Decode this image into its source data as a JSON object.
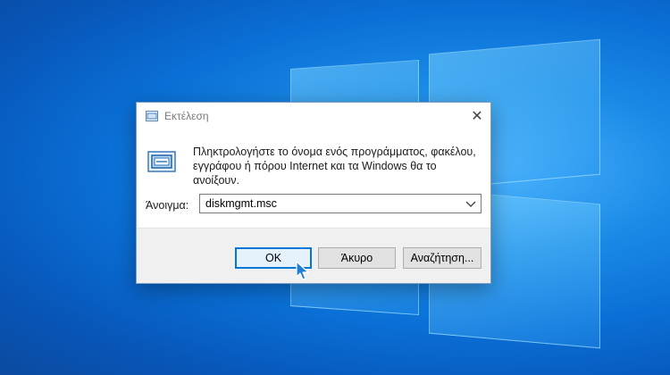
{
  "dialog": {
    "title": "Εκτέλεση",
    "description": "Πληκτρολογήστε το όνομα ενός προγράμματος, φακέλου, εγγράφου ή πόρου Internet και τα Windows θα το ανοίξουν.",
    "open_label": "Άνοιγμα:",
    "open_value": "diskmgmt.msc",
    "buttons": {
      "ok": "OK",
      "cancel": "Άκυρο",
      "browse": "Αναζήτηση..."
    }
  },
  "icons": {
    "title": "run-icon",
    "main": "run-icon",
    "close": "close-icon",
    "dropdown": "chevron-down-icon",
    "cursor": "mouse-pointer-icon"
  },
  "colors": {
    "accent": "#0078d7",
    "desktop": "#0a6fd6"
  }
}
